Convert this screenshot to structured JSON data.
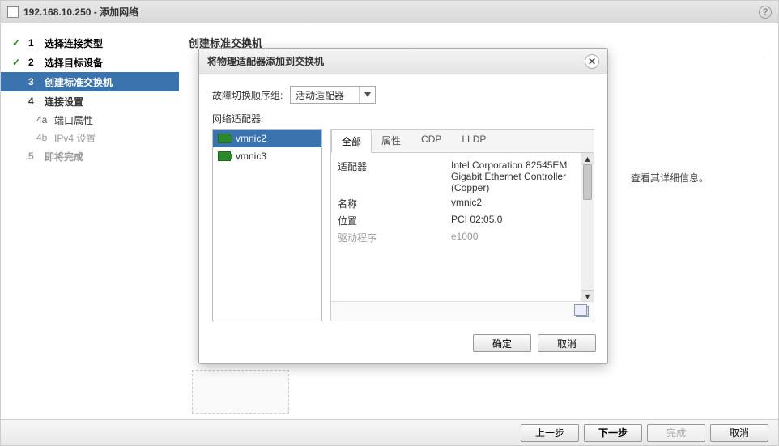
{
  "window": {
    "title": "192.168.10.250 - 添加网络"
  },
  "wizard": {
    "steps": [
      {
        "num": "1",
        "label": "选择连接类型",
        "state": "done"
      },
      {
        "num": "2",
        "label": "选择目标设备",
        "state": "done"
      },
      {
        "num": "3",
        "label": "创建标准交换机",
        "state": "current"
      },
      {
        "num": "4",
        "label": "连接设置",
        "state": "future"
      },
      {
        "num": "5",
        "label": "即将完成",
        "state": "last"
      }
    ],
    "substeps": [
      {
        "num": "4a",
        "label": "端口属性",
        "disabled": false
      },
      {
        "num": "4b",
        "label": "IPv4 设置",
        "disabled": true
      }
    ]
  },
  "content": {
    "section_title": "创建标准交换机",
    "hint_suffix": "查看其详细信息。"
  },
  "modal": {
    "title": "将物理适配器添加到交换机",
    "failover_label": "故障切换顺序组:",
    "failover_value": "活动适配器",
    "adapters_label": "网络适配器:",
    "adapters": [
      {
        "name": "vmnic2",
        "selected": true
      },
      {
        "name": "vmnic3",
        "selected": false
      }
    ],
    "tabs": [
      "全部",
      "属性",
      "CDP",
      "LLDP"
    ],
    "properties": [
      {
        "key": "适配器",
        "value": "Intel Corporation 82545EM Gigabit Ethernet Controller (Copper)"
      },
      {
        "key": "名称",
        "value": "vmnic2"
      },
      {
        "key": "位置",
        "value": "PCI 02:05.0"
      },
      {
        "key": "驱动程序",
        "value": "e1000"
      }
    ],
    "ok": "确定",
    "cancel": "取消"
  },
  "footer": {
    "back": "上一步",
    "next": "下一步",
    "finish": "完成",
    "cancel": "取消"
  }
}
